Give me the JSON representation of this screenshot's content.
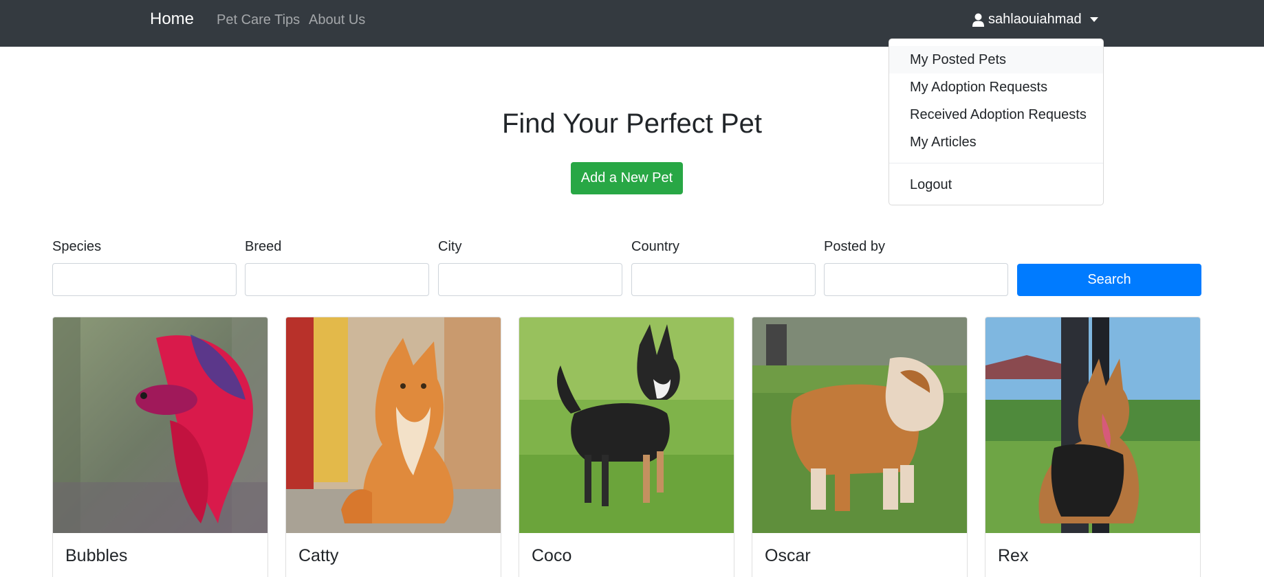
{
  "navbar": {
    "brand": "Home",
    "links": [
      "Pet Care Tips",
      "About Us"
    ],
    "user": "sahlaouiahmad"
  },
  "user_menu": {
    "items": [
      "My Posted Pets",
      "My Adoption Requests",
      "Received Adoption Requests",
      "My Articles"
    ],
    "logout": "Logout"
  },
  "hero": {
    "title": "Find Your Perfect Pet",
    "add_button": "Add a New Pet"
  },
  "filters": {
    "fields": [
      {
        "label": "Species",
        "value": ""
      },
      {
        "label": "Breed",
        "value": ""
      },
      {
        "label": "City",
        "value": ""
      },
      {
        "label": "Country",
        "value": ""
      },
      {
        "label": "Posted by",
        "value": ""
      }
    ],
    "search_button": "Search"
  },
  "pets": [
    {
      "name": "Bubbles",
      "image": "betta-fish-photo"
    },
    {
      "name": "Catty",
      "image": "orange-tabby-cat-photo"
    },
    {
      "name": "Coco",
      "image": "chihuahua-dog-photo"
    },
    {
      "name": "Oscar",
      "image": "english-bulldog-photo"
    },
    {
      "name": "Rex",
      "image": "german-shepherd-photo"
    }
  ],
  "colors": {
    "navbar_bg": "#343a40",
    "add_button": "#28a745",
    "search_button": "#007bff"
  }
}
